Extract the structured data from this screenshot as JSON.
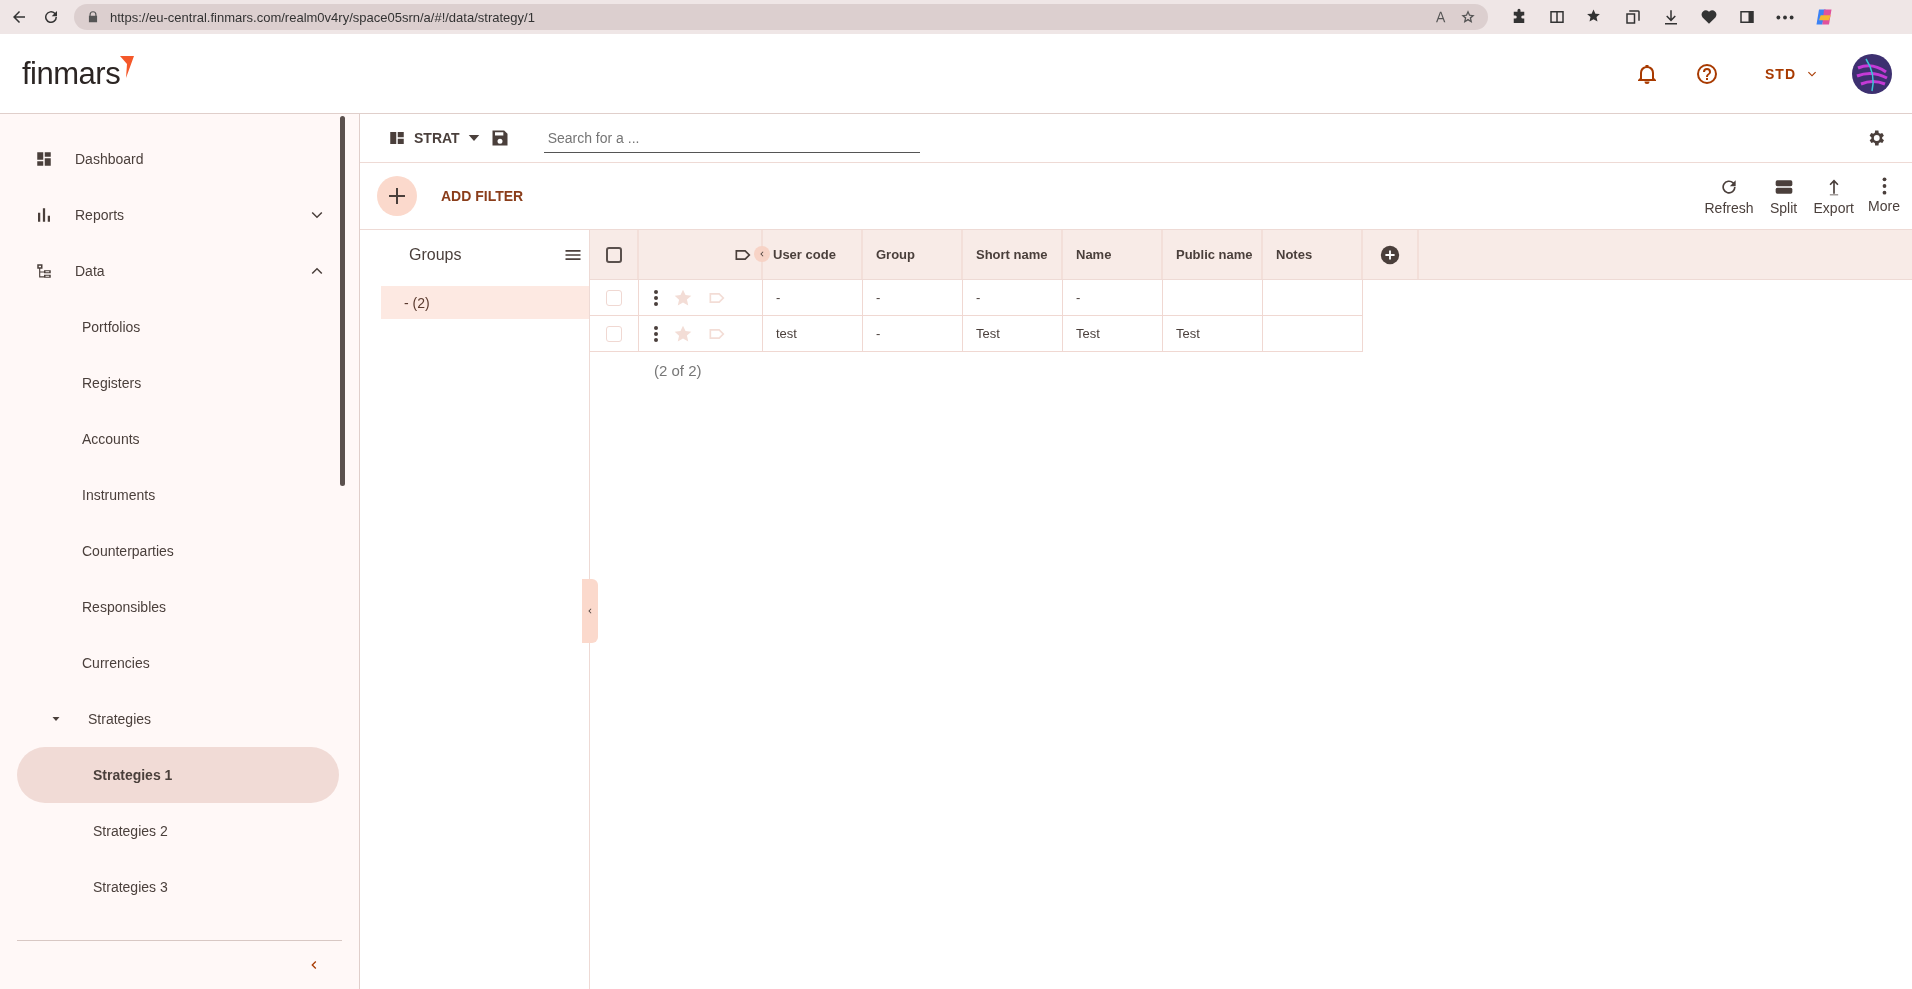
{
  "browser": {
    "url": "https://eu-central.finmars.com/realm0v4ry/space05srn/a/#!/data/strategy/1"
  },
  "header": {
    "logo": "finmars",
    "workspace": "STD"
  },
  "sidebar": {
    "items": [
      {
        "label": "Dashboard",
        "selected": false
      },
      {
        "label": "Reports",
        "selected": false,
        "expanded": false
      },
      {
        "label": "Data",
        "selected": false,
        "expanded": true,
        "children": [
          {
            "label": "Portfolios",
            "selected": false
          },
          {
            "label": "Registers",
            "selected": false
          },
          {
            "label": "Accounts",
            "selected": false
          },
          {
            "label": "Instruments",
            "selected": false
          },
          {
            "label": "Counterparties",
            "selected": false
          },
          {
            "label": "Responsibles",
            "selected": false
          },
          {
            "label": "Currencies",
            "selected": false
          },
          {
            "label": "Strategies",
            "selected": false,
            "expanded": true,
            "children": [
              {
                "label": "Strategies 1",
                "selected": true
              },
              {
                "label": "Strategies 2",
                "selected": false
              },
              {
                "label": "Strategies 3",
                "selected": false
              }
            ]
          }
        ]
      }
    ]
  },
  "toolbar": {
    "layout": "STRAT",
    "search": {
      "placeholder": "Search for a ..."
    }
  },
  "filter_bar": {
    "add_filter": "ADD FILTER",
    "actions": [
      "Refresh",
      "Split",
      "Export",
      "More"
    ]
  },
  "groups": {
    "title": "Groups",
    "items": [
      {
        "label": "- (2)",
        "selected": true
      }
    ]
  },
  "table": {
    "all_checked": false,
    "columns": [
      "User code",
      "Group",
      "Short name",
      "Name",
      "Public name",
      "Notes"
    ],
    "rows": [
      {
        "checked": false,
        "cells": [
          "-",
          "-",
          "-",
          "-",
          "",
          ""
        ]
      },
      {
        "checked": false,
        "cells": [
          "test",
          "-",
          "Test",
          "Test",
          "Test",
          ""
        ]
      }
    ],
    "count": "(2 of 2)"
  }
}
